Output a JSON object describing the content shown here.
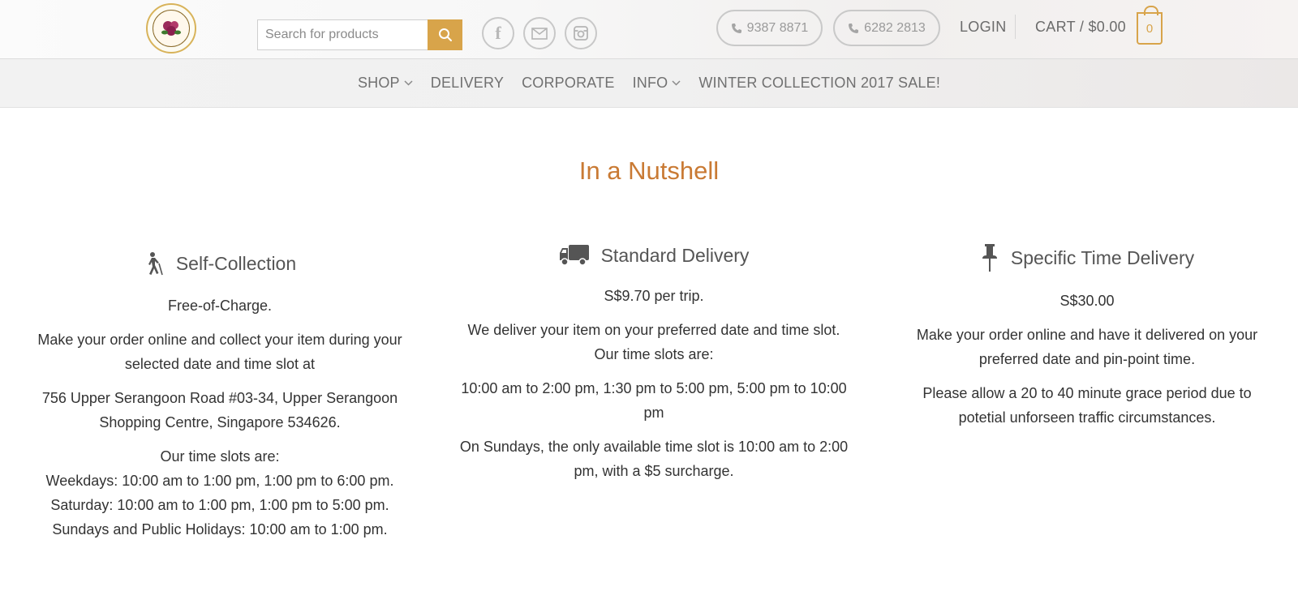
{
  "header": {
    "logo_alt": "Floral Garage Singapore",
    "search": {
      "placeholder": "Search for products",
      "value": ""
    },
    "phones": [
      "9387 8871",
      "6282 2813"
    ],
    "login_label": "LOGIN",
    "cart_label": "CART / $0.00",
    "cart_count": "0",
    "accent_color": "#d8a44a"
  },
  "nav": {
    "items": [
      {
        "label": "SHOP",
        "has_dropdown": true
      },
      {
        "label": "DELIVERY",
        "has_dropdown": false
      },
      {
        "label": "CORPORATE",
        "has_dropdown": false
      },
      {
        "label": "INFO",
        "has_dropdown": true
      },
      {
        "label": "WINTER COLLECTION 2017 SALE!",
        "has_dropdown": false
      }
    ]
  },
  "main": {
    "title": "In a Nutshell",
    "title_color": "#c97a34",
    "columns": [
      {
        "icon": "walking-person-icon",
        "heading": "Self-Collection",
        "price": "Free-of-Charge.",
        "desc": "Make your order online and collect your item during your selected date and time slot at",
        "address": "756 Upper Serangoon Road #03-34, Upper Serangoon Shopping Centre, Singapore 534626.",
        "slots_intro": "Our time slots are:",
        "slots": [
          "Weekdays: 10:00 am to 1:00 pm, 1:00 pm to 6:00 pm.",
          "Saturday: 10:00 am to 1:00 pm, 1:00 pm to 5:00 pm.",
          "Sundays and Public Holidays: 10:00 am to 1:00 pm."
        ]
      },
      {
        "icon": "truck-icon",
        "heading": "Standard Delivery",
        "price": "S$9.70 per trip.",
        "desc": "We deliver your item on your preferred date and time slot. Our time slots are:",
        "slots": "10:00 am to 2:00 pm, 1:30 pm to 5:00 pm, 5:00 pm to 10:00 pm",
        "sunday_note": "On Sundays, the only available time slot is 10:00 am to 2:00 pm, with a $5 surcharge."
      },
      {
        "icon": "pushpin-icon",
        "heading": "Specific Time Delivery",
        "price": "S$30.00",
        "desc": "Make your order online and have it delivered on your preferred date and pin-point time.",
        "note": "Please allow a 20 to 40 minute grace period due to potetial unforseen traffic circumstances."
      }
    ]
  }
}
